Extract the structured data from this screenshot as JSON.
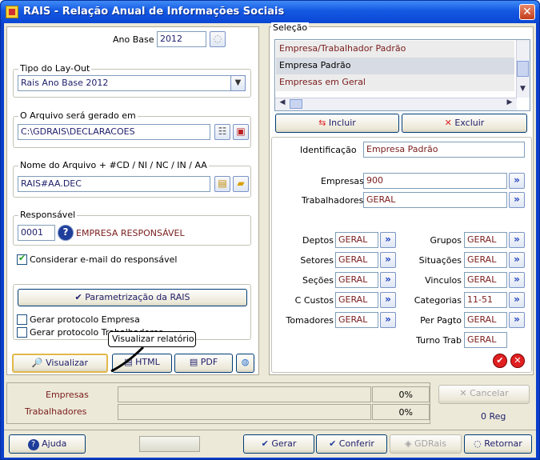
{
  "window": {
    "title": "RAIS - Relação Anual de Informações Sociais"
  },
  "left": {
    "ano_base_label": "Ano Base",
    "ano_base_value": "2012",
    "layout_group": "Tipo do Lay-Out",
    "layout_value": "Rais Ano Base 2012",
    "arquivo_group": "O Arquivo será gerado em",
    "arquivo_value": "C:\\GDRAIS\\DECLARACOES",
    "nome_group": "Nome do Arquivo + #CD / NI / NC / IN / AA",
    "nome_value": "RAIS#AA.DEC",
    "resp_group": "Responsável",
    "resp_code": "0001",
    "resp_name": "EMPRESA RESPONSÁVEL",
    "email_check": "Considerar e-mail do responsável",
    "param_button": "Parametrização da RAIS",
    "protocolo_empresa": "Gerar protocolo Empresa",
    "protocolo_trab": "Gerar protocolo Trabalhadores",
    "tooltip": "Visualizar relatório",
    "visualizar": "Visualizar",
    "html": "HTML",
    "pdf": "PDF"
  },
  "selecao": {
    "label": "Seleção",
    "items": [
      "Empresa/Trabalhador Padrão",
      "Empresa Padrão",
      "Empresas em Geral"
    ],
    "incluir": "Incluir",
    "excluir": "Excluir"
  },
  "form": {
    "identificacao_label": "Identificação",
    "identificacao_value": "Empresa Padrão",
    "empresas_label": "Empresas",
    "empresas_value": "900",
    "trabalhadores_label": "Trabalhadores",
    "trabalhadores_value": "GERAL",
    "left_rows": [
      {
        "label": "Deptos",
        "value": "GERAL"
      },
      {
        "label": "Setores",
        "value": "GERAL"
      },
      {
        "label": "Seções",
        "value": "GERAL"
      },
      {
        "label": "C Custos",
        "value": "GERAL"
      },
      {
        "label": "Tomadores",
        "value": "GERAL"
      }
    ],
    "right_rows": [
      {
        "label": "Grupos",
        "value": "GERAL"
      },
      {
        "label": "Situações",
        "value": "GERAL"
      },
      {
        "label": "Vinculos",
        "value": "GERAL"
      },
      {
        "label": "Categorias",
        "value": "11-51"
      },
      {
        "label": "Per Pagto",
        "value": "GERAL"
      },
      {
        "label": "Turno Trab",
        "value": "GERAL"
      }
    ]
  },
  "progress": {
    "empresas_label": "Empresas",
    "empresas_pct": "0%",
    "trab_label": "Trabalhadores",
    "trab_pct": "0%",
    "cancelar": "Cancelar",
    "reg": "0  Reg"
  },
  "footer": {
    "ajuda": "Ajuda",
    "gerar": "Gerar",
    "conferir": "Conferir",
    "gdrais": "GDRais",
    "retornar": "Retornar"
  }
}
